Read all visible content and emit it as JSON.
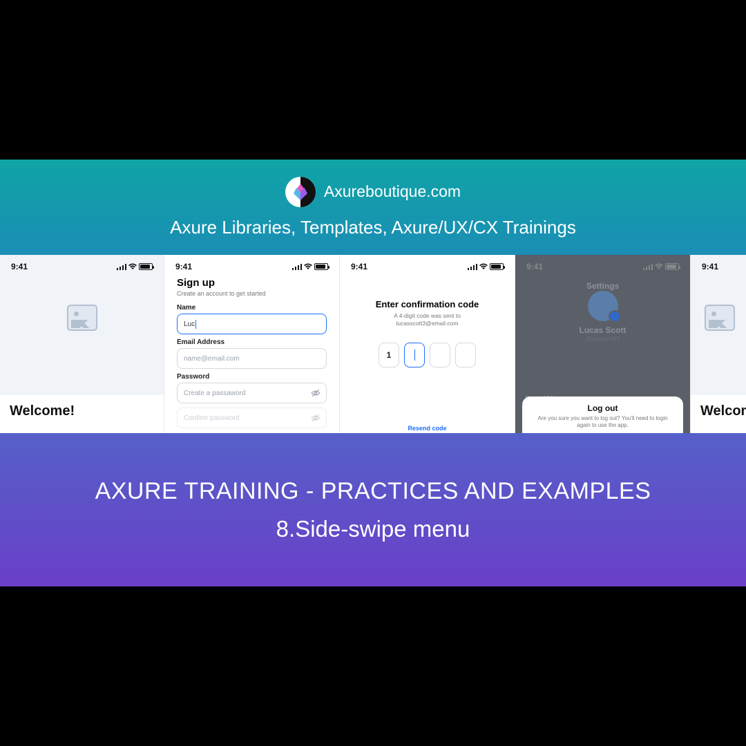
{
  "header": {
    "site_name": "Axureboutique.com",
    "tagline": "Axure Libraries, Templates,  Axure/UX/CX Trainings"
  },
  "status": {
    "time": "9:41"
  },
  "screen0": {
    "welcome": "Welcome!"
  },
  "screen1": {
    "title": "Sign up",
    "subtitle": "Create an account to get started",
    "name_label": "Name",
    "name_value": "Luc",
    "email_label": "Email Address",
    "email_placeholder": "name@email.com",
    "password_label": "Password",
    "password_placeholder": "Create a passaword",
    "confirm_placeholder": "Confirm password"
  },
  "screen2": {
    "title": "Enter confirmation code",
    "sub_line1": "A 4-digit code was sent to",
    "sub_line2": "lucasscott3@email.com",
    "digit1": "1",
    "resend": "Resend code"
  },
  "screen3": {
    "settings": "Settings",
    "name": "Lucas Scott",
    "handle": "@lucasscott3",
    "row1": "Saved Messages",
    "logout_title": "Log out",
    "logout_sub": "Are you sure you want to log out? You'll need to login again to use the app."
  },
  "screen4": {
    "welcome": "Welcome!"
  },
  "footer": {
    "line1": "AXURE TRAINING - PRACTICES AND EXAMPLES",
    "line2": "8.Side-swipe menu"
  }
}
